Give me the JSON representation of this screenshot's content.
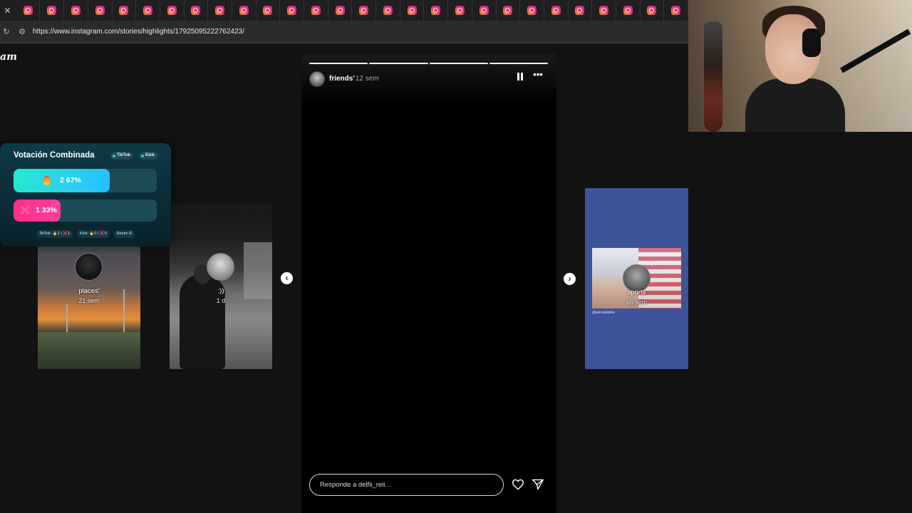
{
  "browser": {
    "tab_count": 28,
    "tab_icon": "instagram-icon",
    "url": "https://www.instagram.com/stories/highlights/17925095222762423/"
  },
  "page": {
    "logo_text": "am"
  },
  "vote_widget": {
    "title": "Votación Combinada",
    "badges": [
      "TikTok",
      "Kick"
    ],
    "options": [
      {
        "icon": "flame-icon",
        "label": "2  67%",
        "fraction": 0.67,
        "color": "#2bd6e6"
      },
      {
        "icon": "x-icon",
        "label": "1  33%",
        "fraction": 0.33,
        "color": "#ff2f86"
      }
    ],
    "footer": [
      "TikTok: 🔥2 / ❌1",
      "Kick: 🔥0 / ❌0",
      "Reset: R"
    ]
  },
  "highlights": {
    "left": [
      {
        "name": "places'",
        "time": "21 sem"
      },
      {
        "name": ":))",
        "time": "1 d"
      }
    ],
    "right": {
      "name": "sports",
      "time": "66 sem",
      "caption": "@simonebiles"
    }
  },
  "story": {
    "username": "friends'",
    "time": "12 sem",
    "progress_segments": 4,
    "reply_placeholder": "Responde a delfii_reii..."
  },
  "colors": {
    "page_bg": "#121212",
    "sports_bg": "#3d539a"
  }
}
